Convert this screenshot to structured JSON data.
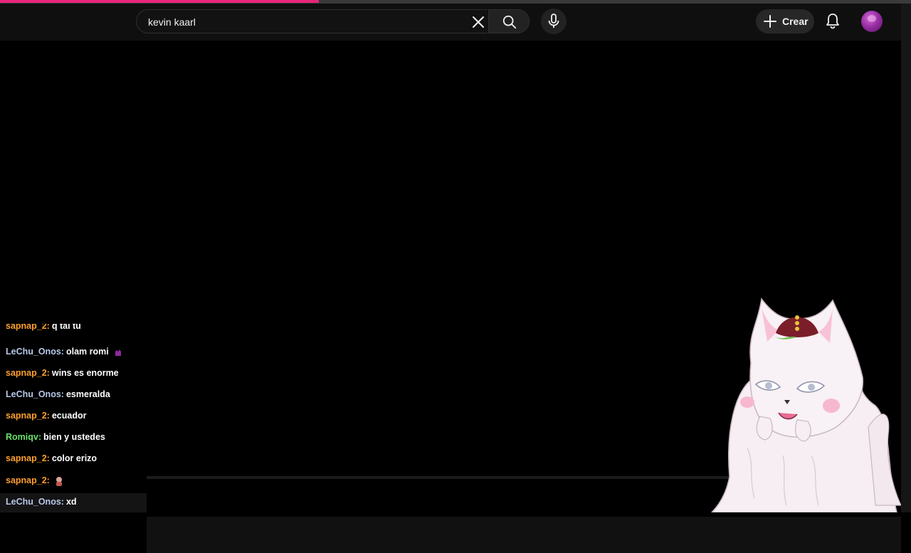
{
  "loading_bar": {
    "progress_percent": 35,
    "color": "#e8257a"
  },
  "header": {
    "search": {
      "value": "kevin kaarl",
      "placeholder": "Buscar"
    },
    "clear_icon": "close-icon",
    "search_icon": "search-icon",
    "mic_icon": "microphone-icon",
    "create_label": "Crear",
    "bell_icon": "bell-icon",
    "avatar_icon": "avatar"
  },
  "chat": {
    "colors": {
      "sapnap_2": "#ff9f2e",
      "LeChu_Onos": "#b8c8e8",
      "Romiqv": "#6be06b"
    },
    "messages": [
      {
        "user": "sapnap_2",
        "text": "q tal tu",
        "color": "#ff9f2e"
      },
      {
        "user": "LeChu_Onos",
        "text": "olam romi",
        "color": "#b8c8e8",
        "emote": "purple-hand-emote"
      },
      {
        "user": "sapnap_2",
        "text": "wins es enorme",
        "color": "#ff9f2e"
      },
      {
        "user": "LeChu_Onos",
        "text": "esmeralda",
        "color": "#b8c8e8"
      },
      {
        "user": "sapnap_2",
        "text": "ecuador",
        "color": "#ff9f2e"
      },
      {
        "user": "Romiqv",
        "text": "bien y ustedes",
        "color": "#6be06b"
      },
      {
        "user": "sapnap_2",
        "text": "color erizo",
        "color": "#ff9f2e"
      },
      {
        "user": "sapnap_2",
        "text": "",
        "color": "#ff9f2e",
        "emote": "character-emote"
      },
      {
        "user": "LeChu_Onos",
        "text": "xd",
        "color": "#b8c8e8"
      }
    ]
  },
  "vtuber": {
    "description_icon": "white-cat-vtuber-avatar"
  }
}
